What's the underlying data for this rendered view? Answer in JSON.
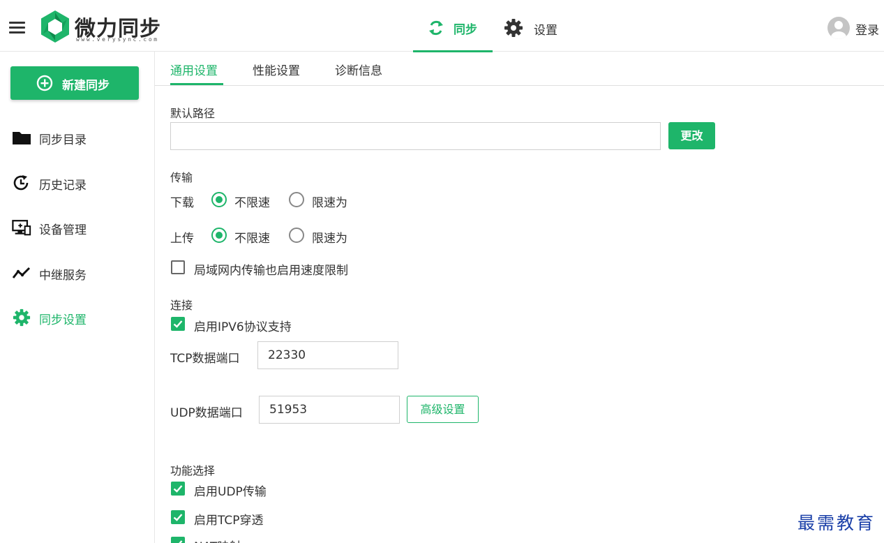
{
  "app": {
    "brand_name": "微力同步",
    "brand_sub": "www.verysync.com",
    "accent_color": "#1eb56a"
  },
  "topnav": {
    "sync_label": "同步",
    "sync_icon": "sync-icon",
    "settings_label": "设置",
    "settings_icon": "gear-icon",
    "active": "同步",
    "login_label": "登录"
  },
  "sidebar": {
    "new_button_label": "新建同步",
    "items": [
      {
        "label": "同步目录",
        "icon": "folder-icon",
        "active": false
      },
      {
        "label": "历史记录",
        "icon": "history-icon",
        "active": false
      },
      {
        "label": "设备管理",
        "icon": "device-icon",
        "active": false
      },
      {
        "label": "中继服务",
        "icon": "relay-icon",
        "active": false
      },
      {
        "label": "同步设置",
        "icon": "gear-icon",
        "active": true
      }
    ]
  },
  "tabs": [
    {
      "label": "通用设置",
      "active": true
    },
    {
      "label": "性能设置",
      "active": false
    },
    {
      "label": "诊断信息",
      "active": false
    }
  ],
  "general": {
    "default_path_label": "默认路径",
    "default_path_value": "",
    "change_button": "更改",
    "transfer": {
      "heading": "传输",
      "download_label": "下载",
      "upload_label": "上传",
      "unlimited_label": "不限速",
      "limited_label": "限速为",
      "download_selected": "不限速",
      "upload_selected": "不限速",
      "lan_limit_label": "局域网内传输也启用速度限制",
      "lan_limit_checked": false
    },
    "connection": {
      "heading": "连接",
      "ipv6_label": "启用IPV6协议支持",
      "ipv6_checked": true,
      "tcp_port_label": "TCP数据端口",
      "tcp_port_value": "22330",
      "udp_port_label": "UDP数据端口",
      "udp_port_value": "51953",
      "advanced_button": "高级设置"
    },
    "features": {
      "heading": "功能选择",
      "items": [
        {
          "label": "启用UDP传输",
          "checked": true
        },
        {
          "label": "启用TCP穿透",
          "checked": true
        },
        {
          "label": "NAT映射",
          "checked": true
        }
      ]
    }
  },
  "watermark": "最需教育"
}
